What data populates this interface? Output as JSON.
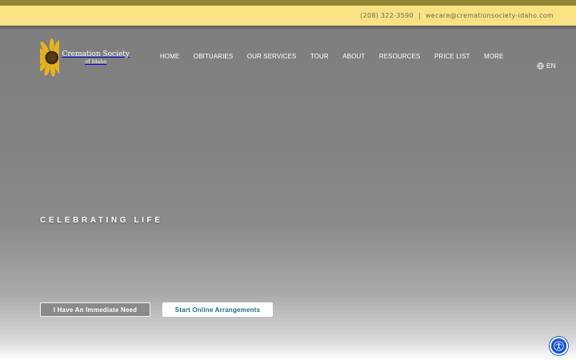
{
  "topbar": {
    "phone": "(208) 322-3590",
    "separator": "|",
    "email": "wecare@cremationsociety-idaho.com"
  },
  "logo": {
    "name": "Cremation Society",
    "sub": "of Idaho",
    "icon": "sunflower-icon"
  },
  "nav": {
    "items": [
      "HOME",
      "OBITUARIES",
      "OUR SERVICES",
      "TOUR",
      "ABOUT",
      "RESOURCES",
      "PRICE LIST",
      "MORE"
    ]
  },
  "language": {
    "label": "EN",
    "icon": "globe-icon"
  },
  "hero": {
    "tagline": "CELEBRATING LIFE",
    "immediate_button": "I Have An Immediate Need",
    "online_button": "Start Online Arrangements"
  },
  "accessibility": {
    "icon": "accessibility-icon"
  },
  "colors": {
    "topbar_bg": "#f8e283",
    "olive_strip": "#8f8432",
    "online_button_text": "#1a6b86",
    "accessibility_bg": "#1454d6"
  }
}
